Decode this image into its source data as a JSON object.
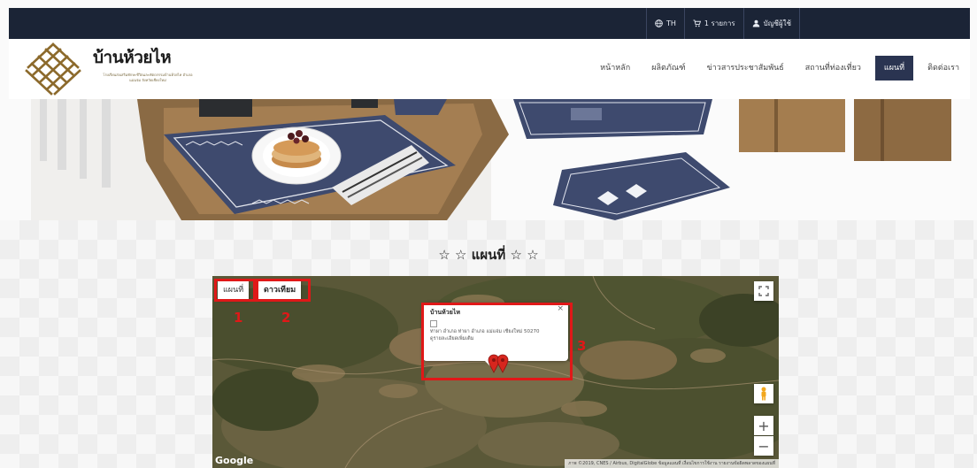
{
  "topbar": {
    "language": "TH",
    "cart": "1 รายการ",
    "account": "บัญชีผู้ใช้"
  },
  "brand": {
    "title": "บ้านห้วยไห",
    "subtitle": "โรงเรียนส่งเสริมทักษะชีวิตและหัตถกรรมบ้านห้วยไห อำเภอแม่แจ่ม จังหวัดเชียงใหม่"
  },
  "nav": {
    "items": [
      {
        "label": "หน้าหลัก"
      },
      {
        "label": "ผลิตภัณฑ์"
      },
      {
        "label": "ข่าวสารประชาสัมพันธ์"
      },
      {
        "label": "สถานที่ท่องเที่ยว"
      },
      {
        "label": "แผนที่",
        "active": true
      },
      {
        "label": "ติดต่อเรา"
      }
    ]
  },
  "section": {
    "title": "☆ ☆ แผนที่ ☆ ☆"
  },
  "map": {
    "map_button": "แผนที่",
    "satellite_button": "ดาวเทียม",
    "annotations": [
      "1",
      "2",
      "3"
    ],
    "infowindow": {
      "title": "บ้านห้วยไห",
      "address": "ท่าผา อำเภอ ท่าผา อำเภอ แม่แจ่ม เชียงใหม่ 50270",
      "more": "ดูรายละเอียดเพิ่มเติม",
      "close": "×"
    },
    "zoom_in": "+",
    "zoom_out": "−",
    "google_logo": "Google",
    "footer_text": "ภาพ ©2019, CNES / Airbus, DigitalGlobe  ข้อมูลแผนที่  เงื่อนไขการใช้งาน  รายงานข้อผิดพลาดของแผนที่"
  },
  "colors": {
    "topbar_bg": "#1b2436",
    "nav_active_bg": "#2a3451",
    "highlight_red": "#e01818",
    "placemat_blue": "#3e4a6e"
  },
  "icons": [
    "globe-icon",
    "cart-icon",
    "user-icon",
    "fullscreen-icon",
    "pegman-icon",
    "marker-icon"
  ]
}
